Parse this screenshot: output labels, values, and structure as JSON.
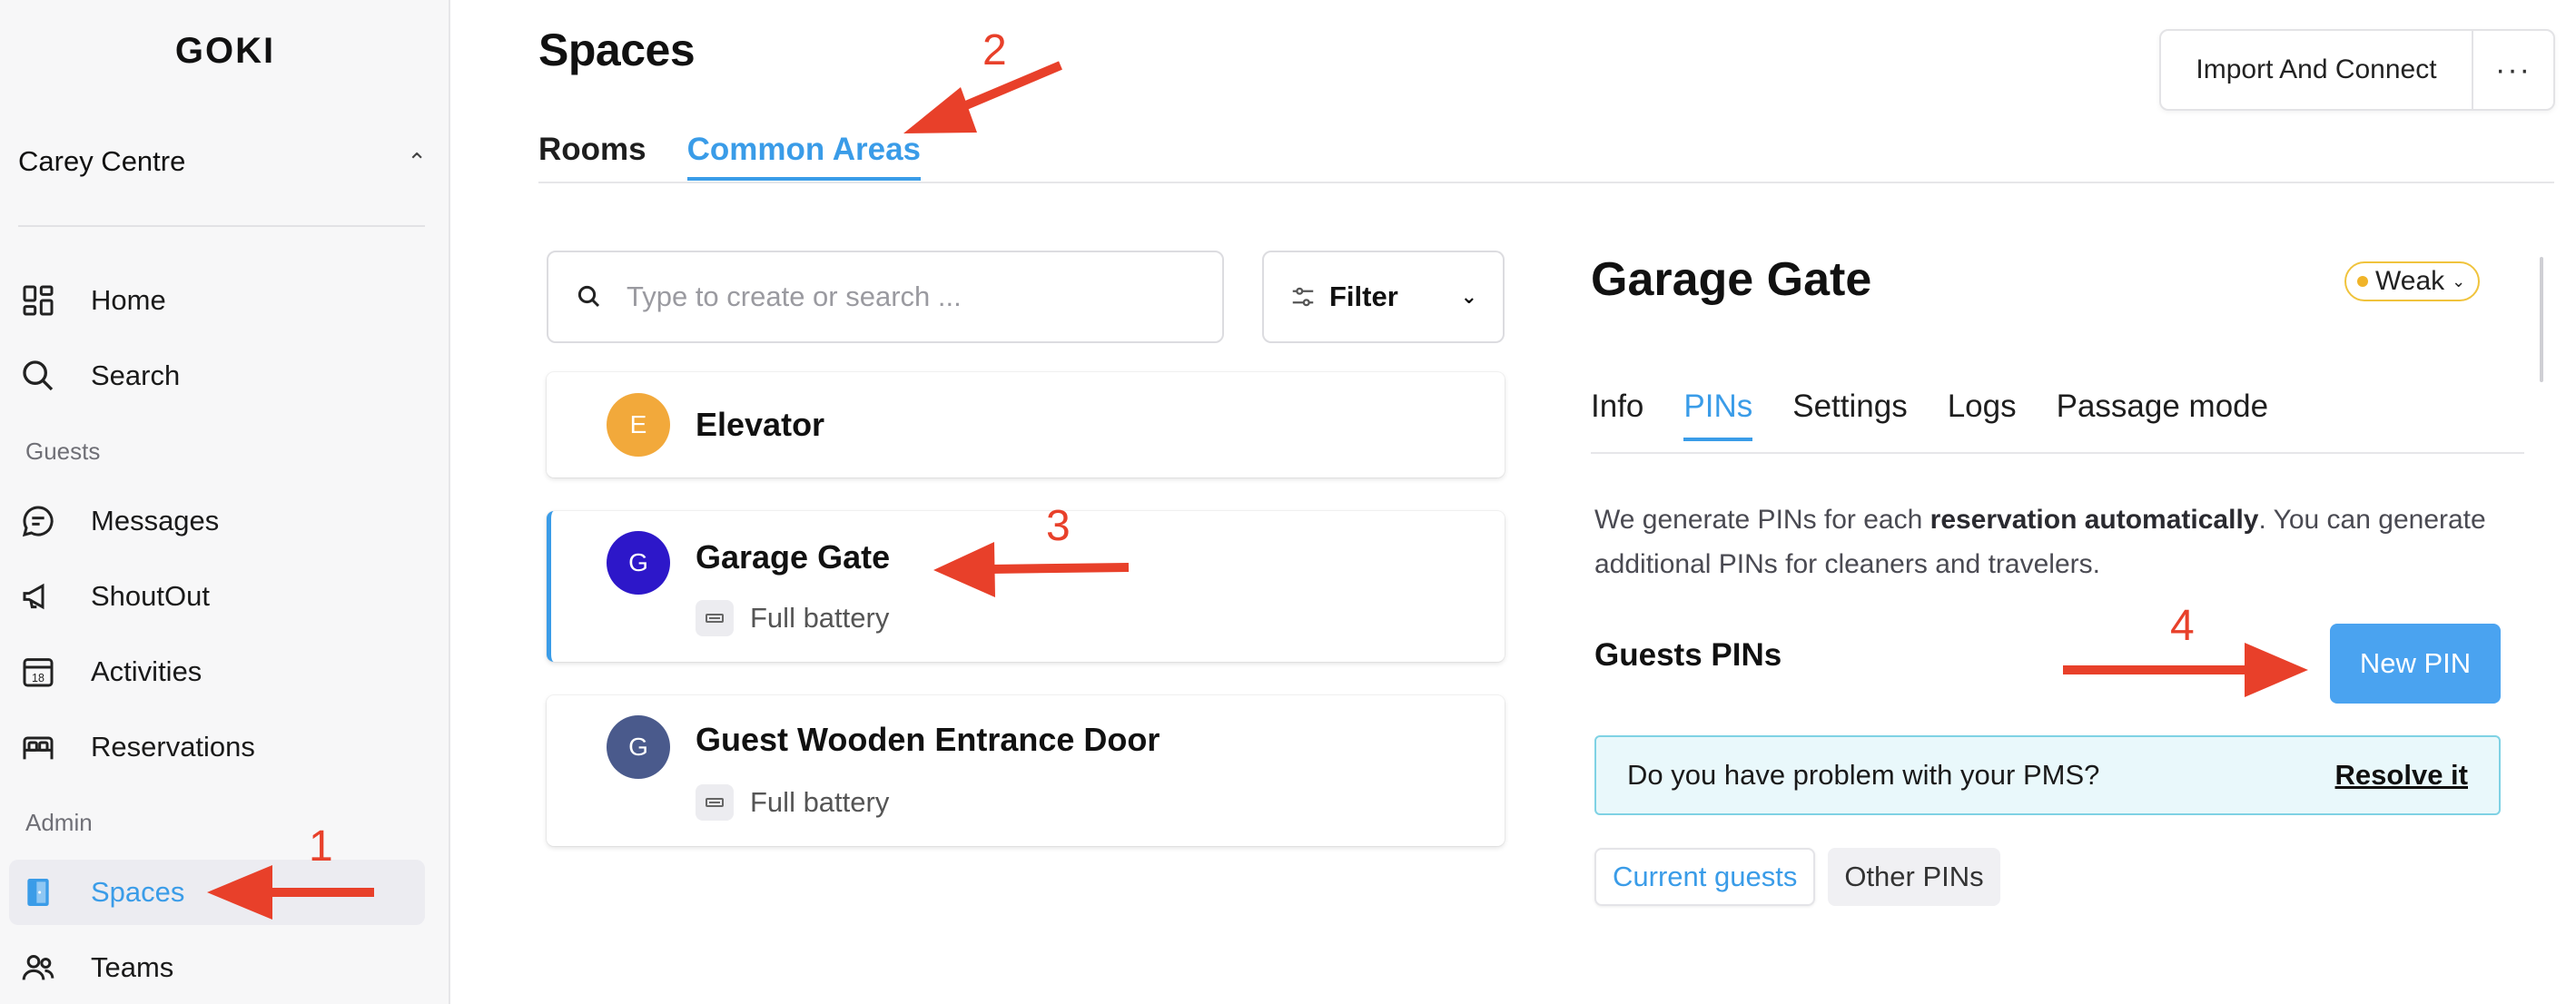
{
  "app": {
    "logo": "GOKI"
  },
  "sidebar": {
    "venue": "Carey Centre",
    "items": [
      {
        "label": "Home",
        "icon": "dashboard-icon"
      },
      {
        "label": "Search",
        "icon": "search-icon"
      }
    ],
    "guests_section": "Guests",
    "guest_items": [
      {
        "label": "Messages",
        "icon": "message-icon"
      },
      {
        "label": "ShoutOut",
        "icon": "megaphone-icon"
      },
      {
        "label": "Activities",
        "icon": "calendar-icon",
        "badge": "18"
      },
      {
        "label": "Reservations",
        "icon": "bed-icon"
      }
    ],
    "admin_section": "Admin",
    "admin_items": [
      {
        "label": "Spaces",
        "icon": "door-icon",
        "active": true
      },
      {
        "label": "Teams",
        "icon": "people-icon"
      }
    ]
  },
  "header": {
    "title": "Spaces",
    "import_label": "Import And Connect",
    "more_label": "···",
    "tabs": [
      {
        "label": "Rooms",
        "active": false
      },
      {
        "label": "Common Areas",
        "active": true
      }
    ]
  },
  "search": {
    "placeholder": "Type to create or search ...",
    "value": ""
  },
  "filter": {
    "label": "Filter"
  },
  "spaces": [
    {
      "initial": "E",
      "name": "Elevator",
      "color": "#f2a93b",
      "battery": ""
    },
    {
      "initial": "G",
      "name": "Garage Gate",
      "color": "#2d17c9",
      "battery": "Full battery",
      "selected": true
    },
    {
      "initial": "G",
      "name": "Guest Wooden Entrance Door",
      "color": "#4a5a8c",
      "battery": "Full battery"
    }
  ],
  "detail": {
    "title": "Garage Gate",
    "signal": "Weak",
    "tabs": [
      {
        "label": "Info",
        "active": false
      },
      {
        "label": "PINs",
        "active": true
      },
      {
        "label": "Settings",
        "active": false
      },
      {
        "label": "Logs",
        "active": false
      },
      {
        "label": "Passage mode",
        "active": false
      }
    ],
    "desc_pre": "We generate PINs for each ",
    "desc_bold": "reservation automatically",
    "desc_post": ". You can generate additional PINs for cleaners and travelers.",
    "guests_pins_label": "Guests PINs",
    "new_pin_label": "New PIN",
    "pms_question": "Do you have problem with your PMS?",
    "pms_resolve": "Resolve it",
    "pin_tabs": [
      {
        "label": "Current guests",
        "active": true
      },
      {
        "label": "Other PINs",
        "active": false
      }
    ]
  },
  "annotations": [
    "1",
    "2",
    "3",
    "4"
  ],
  "colors": {
    "accent": "#3a9ce8",
    "annotation": "#e8402a",
    "new_pin_bg": "#4aa3f0",
    "banner_bg": "#e9f8fb"
  }
}
